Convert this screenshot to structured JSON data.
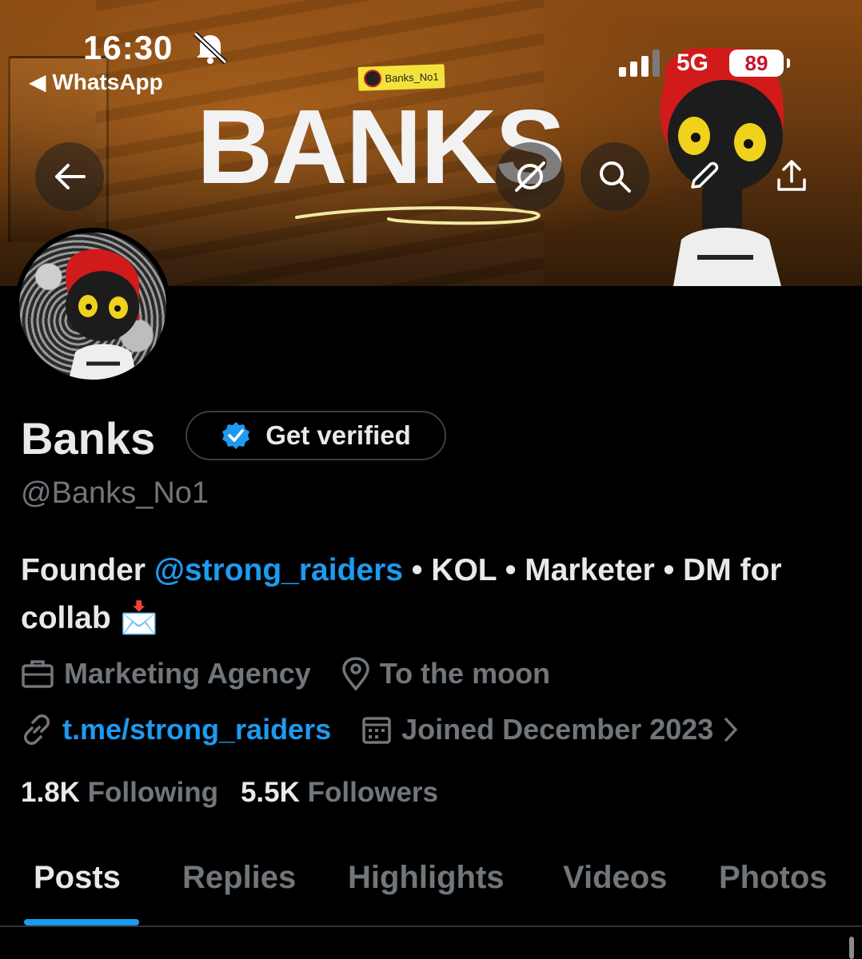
{
  "status_bar": {
    "time": "16:30",
    "back_app": "◀ WhatsApp",
    "network": "5G",
    "battery": "89"
  },
  "banner": {
    "title": "BANKS",
    "tag": "Banks_No1"
  },
  "profile": {
    "display_name": "Banks",
    "get_verified_label": "Get verified",
    "handle": "@Banks_No1",
    "bio_prefix": "Founder ",
    "bio_mention": "@strong_raiders",
    "bio_suffix": " • KOL • Marketer • DM for collab 📩",
    "category": "Marketing Agency",
    "location": "To the moon",
    "website": "t.me/strong_raiders",
    "joined": "Joined December 2023",
    "following_count": "1.8K",
    "following_label": "Following",
    "followers_count": "5.5K",
    "followers_label": "Followers"
  },
  "tabs": [
    {
      "label": "Posts",
      "active": true
    },
    {
      "label": "Replies",
      "active": false
    },
    {
      "label": "Highlights",
      "active": false
    },
    {
      "label": "Videos",
      "active": false
    },
    {
      "label": "Photos",
      "active": false
    }
  ],
  "colors": {
    "accent": "#1d9bf0",
    "muted": "#71767b",
    "text": "#e7e9ea",
    "background": "#000000"
  }
}
